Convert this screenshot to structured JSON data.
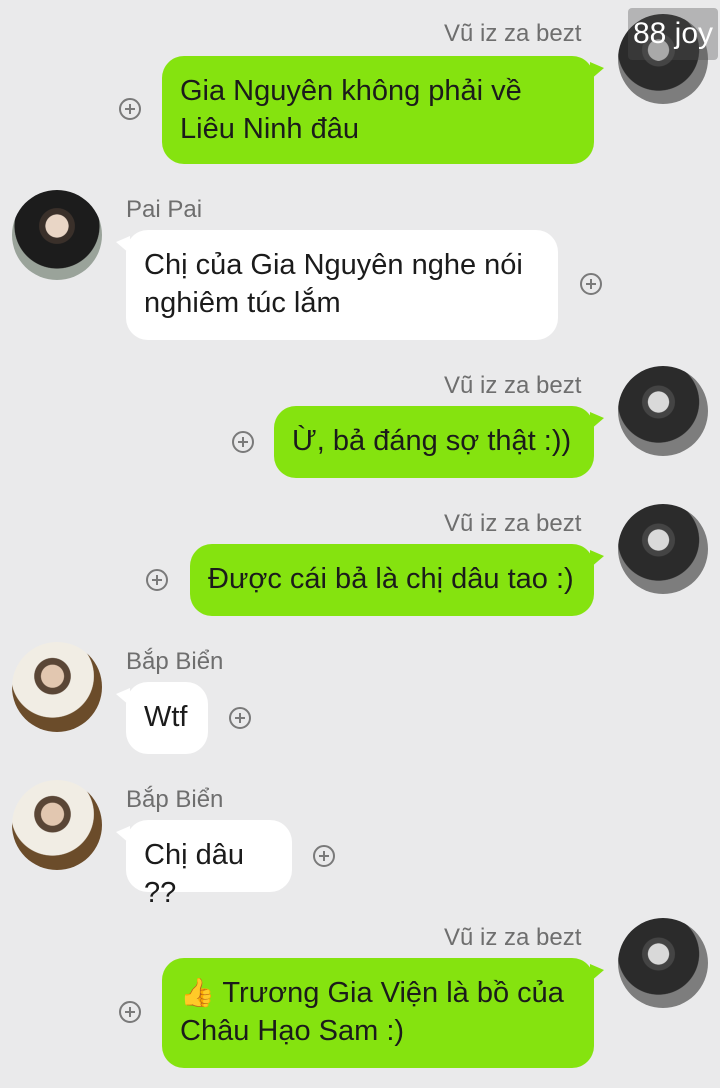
{
  "watermark": "88 joy",
  "messages": [
    {
      "sender": "Vũ iz za bezt",
      "side": "right",
      "avatar": "avatar-vu",
      "lines": [
        "Gia Nguyên không phải về",
        "Liêu Ninh đâu"
      ]
    },
    {
      "sender": "Pai Pai",
      "side": "left",
      "avatar": "avatar-pai",
      "lines": [
        "Chị của Gia Nguyên nghe nói",
        "nghiêm túc lắm"
      ]
    },
    {
      "sender": "Vũ iz za bezt",
      "side": "right",
      "avatar": "avatar-vu",
      "lines": [
        "Ừ, bả đáng sợ thật :))"
      ]
    },
    {
      "sender": "Vũ iz za bezt",
      "side": "right",
      "avatar": "avatar-vu",
      "lines": [
        "Được cái bả là chị dâu tao :)"
      ]
    },
    {
      "sender": "Bắp Biển",
      "side": "left",
      "avatar": "avatar-bap",
      "lines": [
        "Wtf"
      ]
    },
    {
      "sender": "Bắp Biển",
      "side": "left",
      "avatar": "avatar-bap",
      "lines": [
        "Chị dâu ??"
      ]
    },
    {
      "sender": "Vũ iz za bezt",
      "side": "right",
      "avatar": "avatar-vu",
      "emoji": "👍",
      "lines": [
        "Trương Gia Viện là bồ của",
        "Châu Hạo Sam :)"
      ]
    }
  ],
  "colors": {
    "mine": "#85e30f",
    "theirs": "#ffffff",
    "background": "#eaeaeb"
  },
  "icons": {
    "add": "plus-circle-icon",
    "emoji": "thumbs-up-emoji"
  }
}
